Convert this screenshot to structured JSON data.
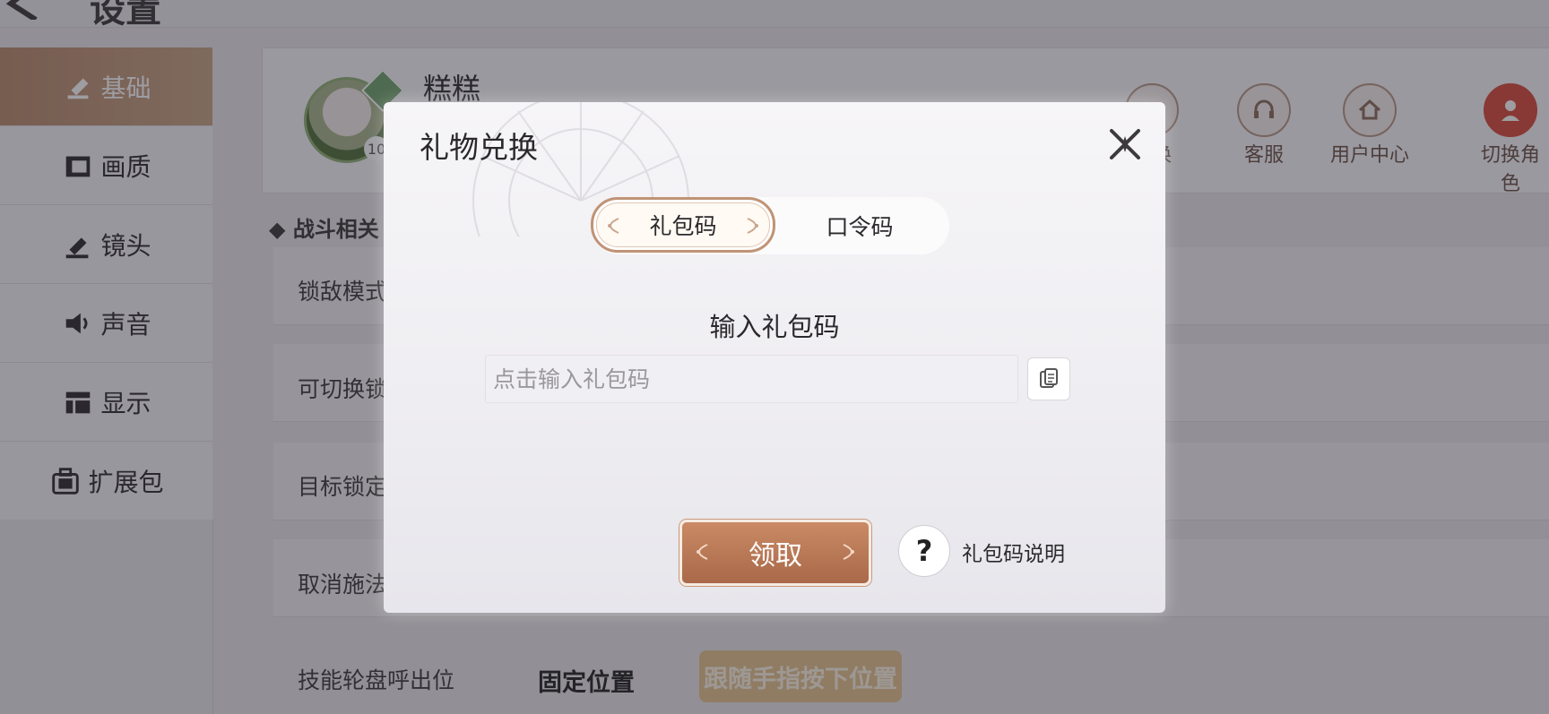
{
  "page": {
    "title": "设置"
  },
  "sidebar": {
    "items": [
      {
        "label": "基础",
        "icon": "hammer-icon"
      },
      {
        "label": "画质",
        "icon": "image-quality-icon"
      },
      {
        "label": "镜头",
        "icon": "camera-icon"
      },
      {
        "label": "声音",
        "icon": "speaker-icon"
      },
      {
        "label": "显示",
        "icon": "layout-icon"
      },
      {
        "label": "扩展包",
        "icon": "package-icon"
      }
    ],
    "active_index": 0
  },
  "profile": {
    "nickname": "糕糕",
    "level_partial": "10",
    "actions": [
      {
        "label": "兑换",
        "icon": "gift-icon"
      },
      {
        "label": "客服",
        "icon": "headset-icon"
      },
      {
        "label": "用户中心",
        "icon": "home-icon"
      },
      {
        "label": "切换角色",
        "icon": "switch-user-icon"
      }
    ]
  },
  "settings": {
    "section_title": "战斗相关",
    "rows": [
      {
        "label": "锁敌模式"
      },
      {
        "label": "可切换锁"
      },
      {
        "label": "目标锁定"
      },
      {
        "label": "取消施法"
      },
      {
        "label": "技能轮盘呼出位"
      }
    ],
    "wheel_options": {
      "fixed": "固定位置",
      "follow": "跟随手指按下位置"
    }
  },
  "dialog": {
    "title": "礼物兑换",
    "tabs": [
      {
        "label": "礼包码",
        "selected": true
      },
      {
        "label": "口令码",
        "selected": false
      }
    ],
    "input_title": "输入礼包码",
    "input": {
      "value": "",
      "placeholder": "点击输入礼包码"
    },
    "claim_label": "领取",
    "help_icon_glyph": "?",
    "help_label": "礼包码说明"
  },
  "colors": {
    "accent_brown": "#b07454",
    "sidebar_active": "#bf9576",
    "follow_option": "#e4c48c"
  }
}
